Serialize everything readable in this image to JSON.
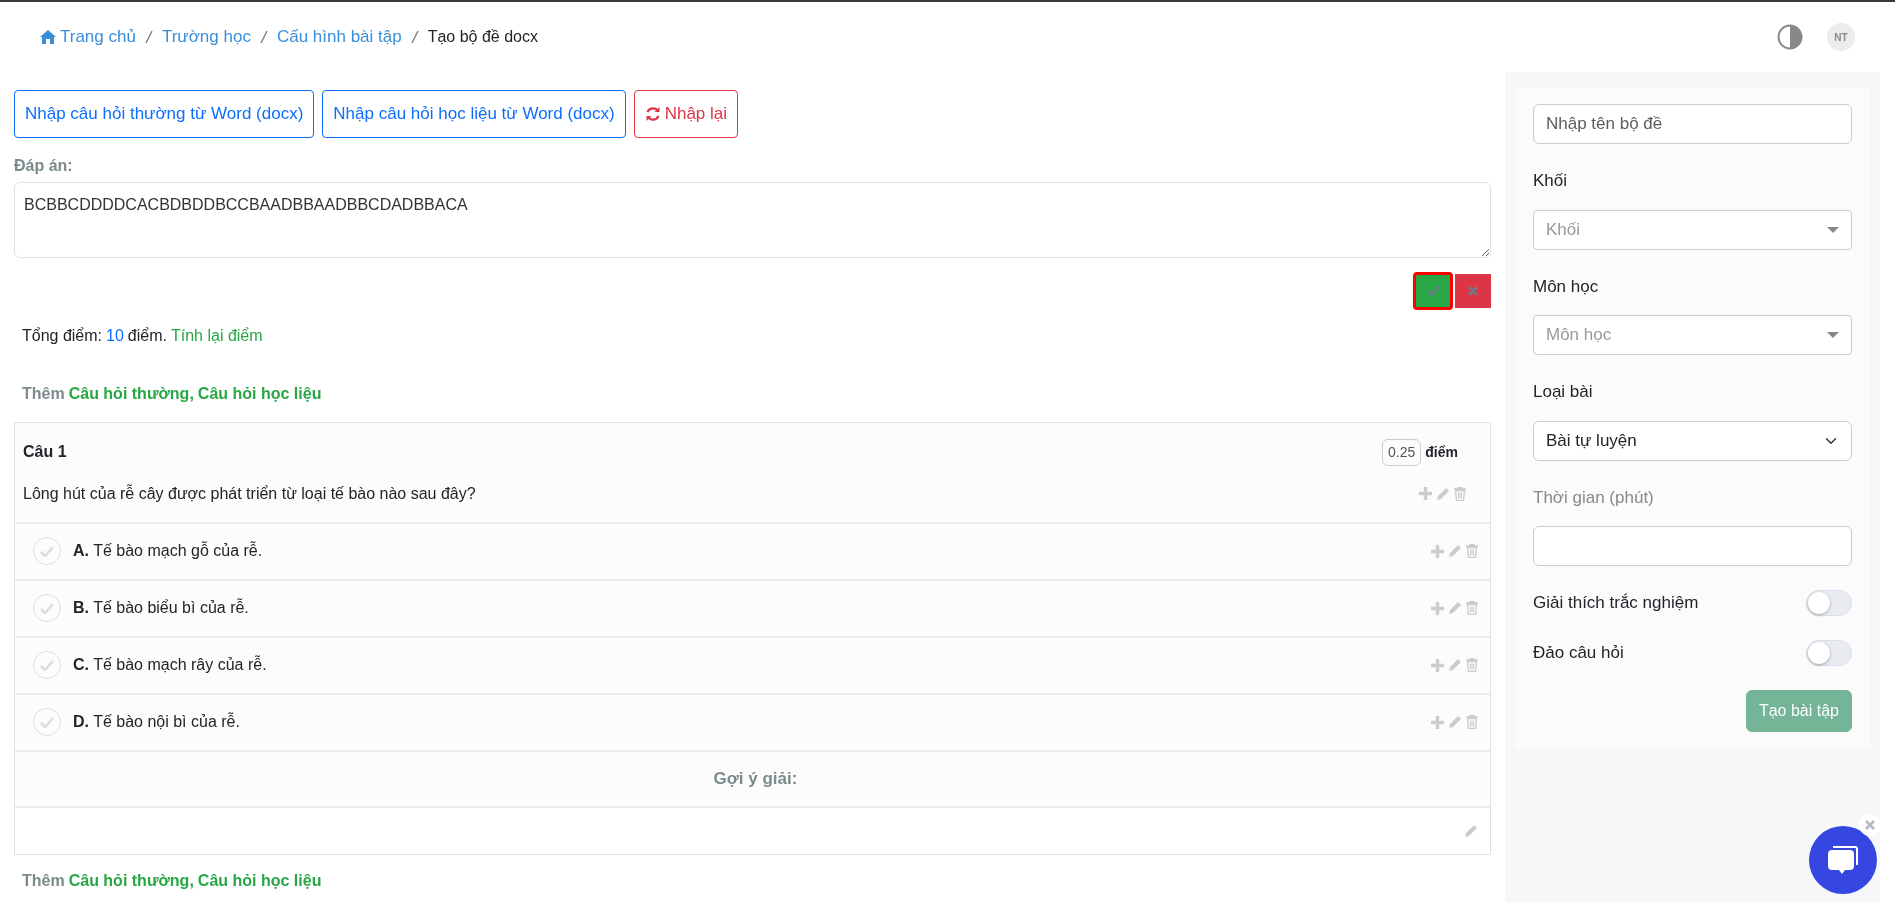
{
  "breadcrumb": [
    {
      "label": "Trang chủ",
      "kind": "home"
    },
    {
      "label": "Trường học",
      "kind": "link"
    },
    {
      "label": "Cấu hình bài tập",
      "kind": "link"
    },
    {
      "label": "Tạo bộ đề docx",
      "kind": "current"
    }
  ],
  "header": {
    "avatar": "NT"
  },
  "import_buttons": [
    {
      "label": "Nhập câu hỏi thường từ Word (docx)",
      "kind": "primary"
    },
    {
      "label": "Nhập câu hỏi học liệu từ Word (docx)",
      "kind": "primary"
    },
    {
      "label": "Nhập lại",
      "kind": "danger"
    }
  ],
  "answer_key": {
    "label": "Đáp án:",
    "value": "BCBBCDDDDCACBDBDDBCCBAADBBAADBBCDADBBACA",
    "confirm_focused": true
  },
  "total": {
    "prefix": "Tổng điểm:",
    "points": "10",
    "suffix": "điểm.",
    "recalc": "Tính lại điểm"
  },
  "add_sections": [
    {
      "prefix": "Thêm",
      "links": [
        "Câu hỏi thường",
        "Câu hỏi học liệu"
      ],
      "separator": ","
    },
    {
      "prefix": "Thêm",
      "links": [
        "Câu hỏi thường",
        "Câu hỏi học liệu"
      ],
      "separator": ","
    }
  ],
  "questions": [
    {
      "title": "Câu 1",
      "score": "0.25",
      "score_unit": "điểm",
      "text": "Lông hút của rễ cây được phát triển từ loại tế bào nào sau đây?",
      "options": [
        {
          "letter": "A.",
          "text": "Tế bào mạch gỗ của rễ.",
          "checked": false
        },
        {
          "letter": "B.",
          "text": "Tế bào biểu bì của rễ.",
          "checked": false
        },
        {
          "letter": "C.",
          "text": "Tế bào mạch rây của rễ.",
          "checked": false
        },
        {
          "letter": "D.",
          "text": "Tế bào nội bì của rễ.",
          "checked": false
        }
      ],
      "hint_label": "Gợi ý giải:"
    }
  ],
  "sidebar": {
    "name_placeholder": "Nhập tên bộ đề",
    "fields": [
      {
        "label": "Khối",
        "kind": "select2",
        "placeholder": "Khối",
        "disabled": false
      },
      {
        "label": "Môn học",
        "kind": "select2",
        "placeholder": "Môn học",
        "disabled": false
      },
      {
        "label": "Loại bài",
        "kind": "select",
        "value": "Bài tự luyện",
        "disabled": false
      },
      {
        "label": "Thời gian (phút)",
        "kind": "number",
        "disabled": true
      }
    ],
    "toggles": [
      {
        "label": "Giải thích trắc nghiệm",
        "on": false
      },
      {
        "label": "Đảo câu hỏi",
        "on": false
      }
    ],
    "submit": {
      "label": "Tạo bài tập",
      "disabled": true
    }
  }
}
